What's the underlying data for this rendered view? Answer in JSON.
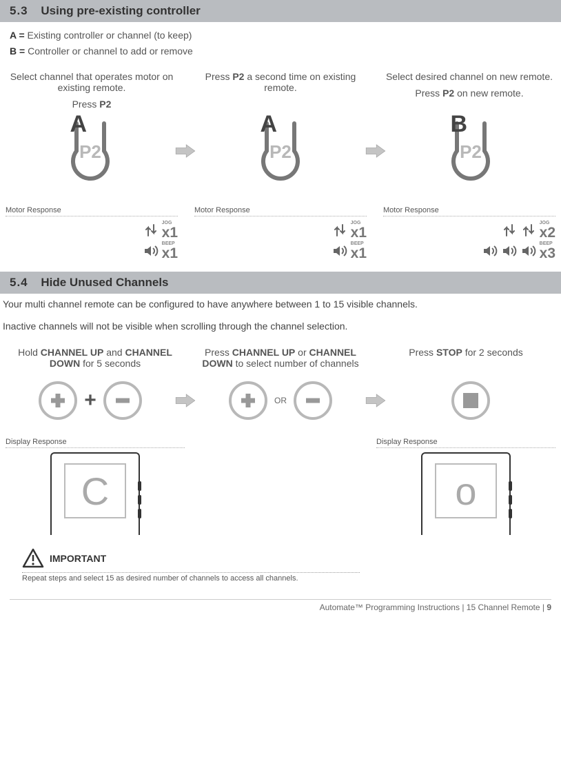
{
  "section53": {
    "num": "5.3",
    "title": "Using pre-existing controller",
    "defA_key": "A =",
    "defA_val": "Existing controller or channel (to keep)",
    "defB_key": "B =",
    "defB_val": "Controller or channel to add or remove",
    "steps": [
      {
        "line1": "Select channel that operates motor on existing remote.",
        "line2_pre": "Press ",
        "line2_bold": "P2",
        "line2_post": "",
        "label": "A"
      },
      {
        "line1_pre": "Press ",
        "line1_bold": "P2",
        "line1_post": " a second time on existing remote.",
        "line2": "",
        "label": "A"
      },
      {
        "line1": "Select desired channel on new remote.",
        "line2_pre": "Press ",
        "line2_bold": "P2",
        "line2_post": " on new remote.",
        "label": "B"
      }
    ],
    "motor_label": "Motor Response",
    "responses": [
      {
        "jogs": 1,
        "jog_x": "x1",
        "beeps": 1,
        "beep_x": "x1"
      },
      {
        "jogs": 1,
        "jog_x": "x1",
        "beeps": 1,
        "beep_x": "x1"
      },
      {
        "jogs": 2,
        "jog_x": "x2",
        "beeps": 3,
        "beep_x": "x3"
      }
    ],
    "jog_label": "JOG",
    "beep_label": "BEEP"
  },
  "section54": {
    "num": "5.4",
    "title": "Hide Unused Channels",
    "para1": "Your multi channel remote can be configured to have anywhere between 1 to 15 visible channels.",
    "para2": "Inactive channels will not be visible when scrolling through the channel selection.",
    "steps": [
      {
        "pre": "Hold ",
        "b1": "CHANNEL UP",
        "mid": " and ",
        "b2": "CHANNEL DOWN",
        "post": " for 5 seconds"
      },
      {
        "pre": "Press ",
        "b1": "CHANNEL UP",
        "mid": " or ",
        "b2": "CHANNEL DOWN",
        "post": " to select number of channels"
      },
      {
        "pre": "Press ",
        "b1": "STOP",
        "mid": "",
        "b2": "",
        "post": " for 2 seconds"
      }
    ],
    "plus": "+",
    "or": "OR",
    "display_label": "Display Response",
    "displays": [
      "C",
      "o"
    ],
    "important_label": "IMPORTANT",
    "important_text": "Repeat steps and select 15 as desired number of channels to access all channels."
  },
  "footer": {
    "brand": "Automate™ Programming Instructions",
    "sep": " | ",
    "model": "15 Channel Remote",
    "page": "9"
  }
}
